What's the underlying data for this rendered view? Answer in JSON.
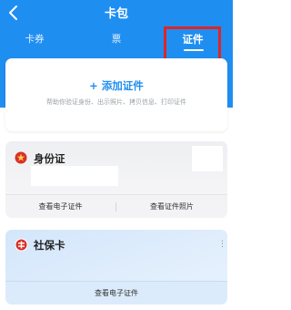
{
  "header": {
    "title": "卡包",
    "tabs": [
      {
        "label": "卡券"
      },
      {
        "label": "票"
      },
      {
        "label": "证件"
      }
    ]
  },
  "add_card": {
    "link_label": "+ 添加证件",
    "description": "帮助你验证身份、出示照片、拷贝信息、打印证件"
  },
  "id_card": {
    "title": "身份证",
    "actions": [
      "查看电子证件",
      "查看证件照片"
    ]
  },
  "social_card": {
    "title": "社保卡",
    "more": "⋮",
    "action": "查看电子证件"
  },
  "colors": {
    "brand_blue": "#1f8ef1",
    "highlight_red": "#e02424"
  },
  "icons": [
    "back-icon",
    "emblem-icon",
    "social-security-logo-icon",
    "more-icon"
  ]
}
